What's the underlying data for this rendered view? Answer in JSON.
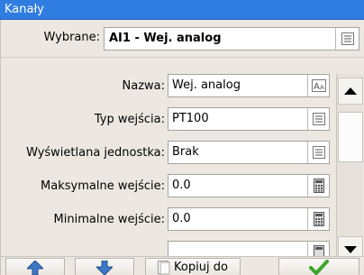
{
  "window": {
    "title": "Kanały"
  },
  "selected": {
    "label": "Wybrane:",
    "value": "AI1 - Wej. analog",
    "button_icon": "list-icon"
  },
  "fields": [
    {
      "label": "Nazwa:",
      "value": "Wej. analog",
      "button_icon": "font-icon"
    },
    {
      "label": "Typ wejścia:",
      "value": "PT100",
      "button_icon": "list-icon"
    },
    {
      "label": "Wyświetlana jednostka:",
      "value": "Brak",
      "button_icon": "list-icon"
    },
    {
      "label": "Maksymalne wejście:",
      "value": "0.0",
      "button_icon": "calculator-icon"
    },
    {
      "label": "Minimalne wejście:",
      "value": "0.0",
      "button_icon": "calculator-icon"
    }
  ],
  "toolbar": {
    "up_icon": "arrow-up-icon",
    "down_icon": "arrow-down-icon",
    "copy_label": "Kopiuj do",
    "confirm_icon": "checkmark-icon"
  },
  "colors": {
    "title_bar": "#2f7de0",
    "confirm_green": "#3aa52b",
    "arrow_blue": "#3d78c8"
  }
}
